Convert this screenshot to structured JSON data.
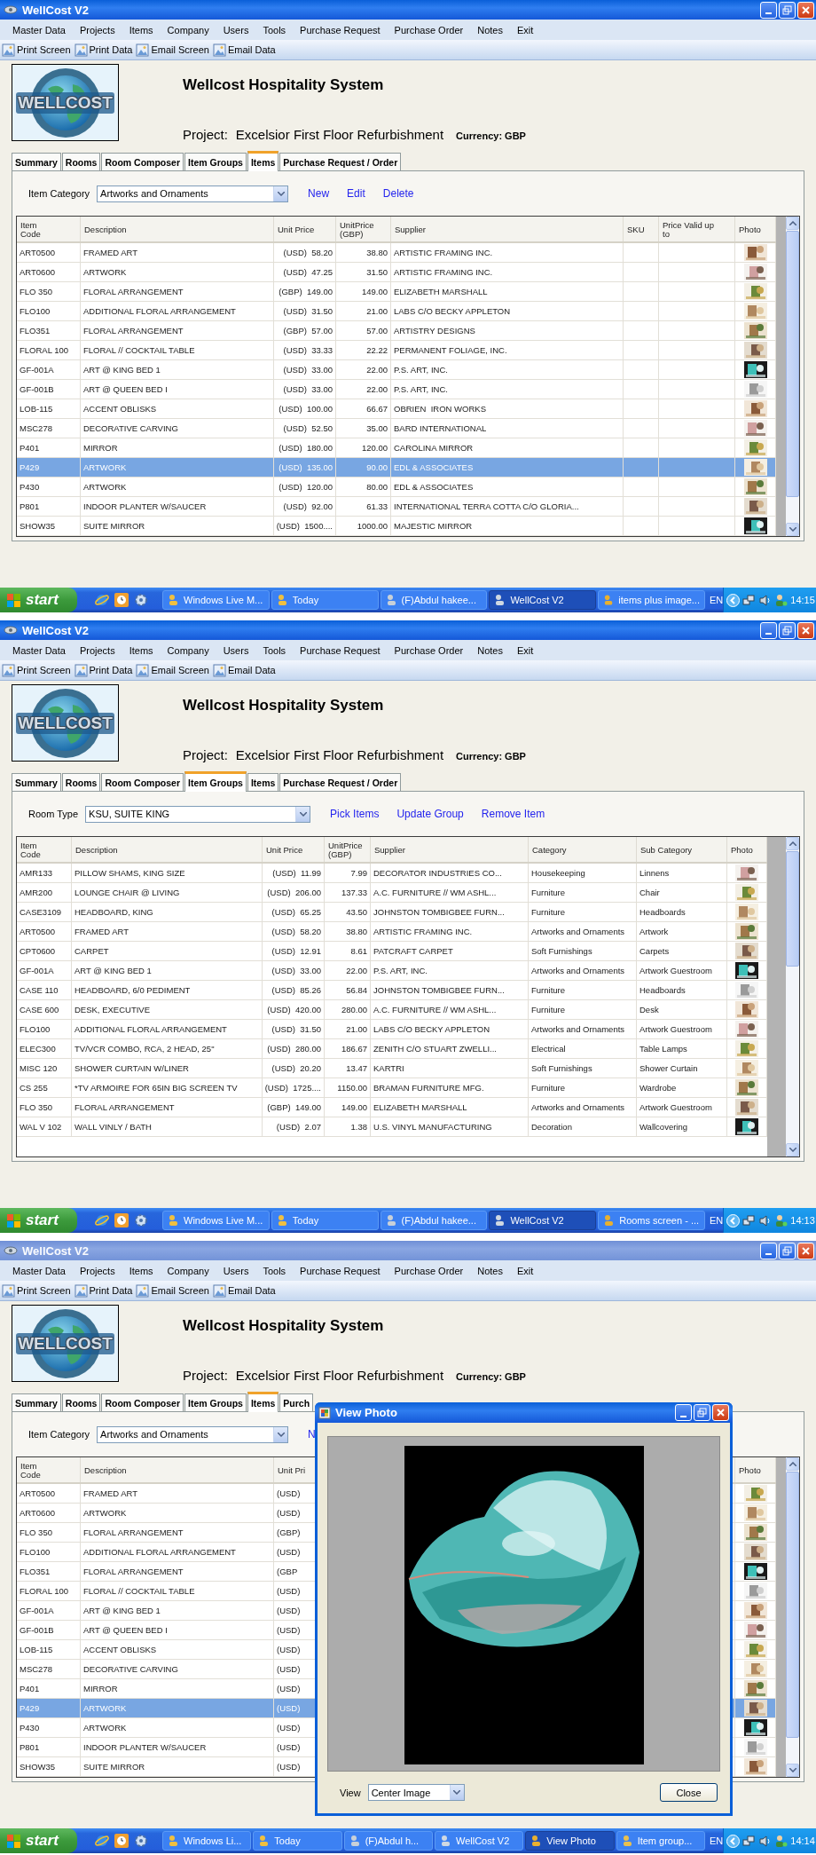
{
  "screens": [
    {
      "window": {
        "title": "WellCost V2",
        "active": true
      },
      "menu": [
        "Master Data",
        "Projects",
        "Items",
        "Company",
        "Users",
        "Tools",
        "Purchase Request",
        "Purchase Order",
        "Notes",
        "Exit"
      ],
      "toolbar": [
        "Print Screen",
        "Print Data",
        "Email Screen",
        "Email Data"
      ],
      "logo_text": "WELLCOST",
      "system_title": "Wellcost Hospitality System",
      "project_label": "Project:",
      "project_name": "Excelsior First Floor Refurbishment",
      "currency": "Currency: GBP",
      "tabs": [
        {
          "label": "Summary",
          "selected": false
        },
        {
          "label": "Rooms",
          "selected": false
        },
        {
          "label": "Room Composer",
          "selected": false
        },
        {
          "label": "Item Groups",
          "selected": false
        },
        {
          "label": "Items",
          "selected": true
        },
        {
          "label": "Purchase Request / Order",
          "selected": false
        }
      ],
      "filter": {
        "label": "Item Category",
        "value": "Artworks and Ornaments"
      },
      "actions": [
        "New",
        "Edit",
        "Delete"
      ],
      "table": {
        "columns": [
          {
            "label": "Item\nCode",
            "kind": "text"
          },
          {
            "label": "Description",
            "kind": "text"
          },
          {
            "label": "Unit Price",
            "kind": "text"
          },
          {
            "label": "UnitPrice\n(GBP)",
            "kind": "text"
          },
          {
            "label": "Supplier",
            "kind": "text"
          },
          {
            "label": "SKU",
            "kind": "text"
          },
          {
            "label": "Price Valid up\nto",
            "kind": "text"
          },
          {
            "label": "Photo"
          }
        ],
        "rows": [
          {
            "cells": [
              "ART0500",
              "FRAMED ART",
              "(USD)  58.20",
              "38.80",
              "ARTISTIC FRAMING INC."
            ],
            "selected": false
          },
          {
            "cells": [
              "ART0600",
              "ARTWORK",
              "(USD)  47.25",
              "31.50",
              "ARTISTIC FRAMING INC."
            ],
            "selected": false
          },
          {
            "cells": [
              "FLO 350",
              "FLORAL ARRANGEMENT",
              "(GBP)  149.00",
              "149.00",
              "ELIZABETH MARSHALL"
            ],
            "selected": false
          },
          {
            "cells": [
              "FLO100",
              "ADDITIONAL FLORAL ARRANGEMENT",
              "(USD)  31.50",
              "21.00",
              "LABS C/O BECKY APPLETON"
            ],
            "selected": false
          },
          {
            "cells": [
              "FLO351",
              "FLORAL ARRANGEMENT",
              "(GBP)  57.00",
              "57.00",
              "ARTISTRY DESIGNS"
            ],
            "selected": false
          },
          {
            "cells": [
              "FLORAL 100",
              "FLORAL // COCKTAIL TABLE",
              "(USD)  33.33",
              "22.22",
              "PERMANENT FOLIAGE, INC."
            ],
            "selected": false
          },
          {
            "cells": [
              "GF-001A",
              "ART @ KING BED 1",
              "(USD)  33.00",
              "22.00",
              "P.S. ART, INC."
            ],
            "selected": false
          },
          {
            "cells": [
              "GF-001B",
              "ART @ QUEEN BED I",
              "(USD)  33.00",
              "22.00",
              "P.S. ART, INC."
            ],
            "selected": false
          },
          {
            "cells": [
              "LOB-115",
              "ACCENT OBLISKS",
              "(USD)  100.00",
              "66.67",
              "OBRIEN  IRON WORKS"
            ],
            "selected": false
          },
          {
            "cells": [
              "MSC278",
              "DECORATIVE CARVING",
              "(USD)  52.50",
              "35.00",
              "BARD INTERNATIONAL"
            ],
            "selected": false
          },
          {
            "cells": [
              "P401",
              "MIRROR",
              "(USD)  180.00",
              "120.00",
              "CAROLINA MIRROR"
            ],
            "selected": false
          },
          {
            "cells": [
              "P429",
              "ARTWORK",
              "(USD)  135.00",
              "90.00",
              "EDL & ASSOCIATES"
            ],
            "selected": true
          },
          {
            "cells": [
              "P430",
              "ARTWORK",
              "(USD)  120.00",
              "80.00",
              "EDL & ASSOCIATES"
            ],
            "selected": false
          },
          {
            "cells": [
              "P801",
              "INDOOR PLANTER W/SAUCER",
              "(USD)  92.00",
              "61.33",
              "INTERNATIONAL TERRA COTTA C/O GLORIA..."
            ],
            "selected": false
          },
          {
            "cells": [
              "SHOW35",
              "SUITE MIRROR",
              "(USD)  1500....",
              "1000.00",
              "MAJESTIC MIRROR"
            ],
            "selected": false
          }
        ]
      },
      "taskbar": {
        "start": "start",
        "tasks": [
          {
            "label": "Windows Live M...",
            "selected": false
          },
          {
            "label": "Today",
            "selected": false
          },
          {
            "label": "(F)Abdul hakee...",
            "selected": false
          },
          {
            "label": "WellCost V2",
            "selected": true
          },
          {
            "label": "items plus image...",
            "selected": false
          }
        ],
        "language": "EN",
        "clock": "14:15"
      }
    },
    {
      "window": {
        "title": "WellCost V2",
        "active": true
      },
      "menu": [
        "Master Data",
        "Projects",
        "Items",
        "Company",
        "Users",
        "Tools",
        "Purchase Request",
        "Purchase Order",
        "Notes",
        "Exit"
      ],
      "toolbar": [
        "Print Screen",
        "Print Data",
        "Email Screen",
        "Email Data"
      ],
      "logo_text": "WELLCOST",
      "system_title": "Wellcost Hospitality System",
      "project_label": "Project:",
      "project_name": "Excelsior First Floor Refurbishment",
      "currency": "Currency: GBP",
      "tabs": [
        {
          "label": "Summary",
          "selected": false
        },
        {
          "label": "Rooms",
          "selected": false
        },
        {
          "label": "Room Composer",
          "selected": false
        },
        {
          "label": "Item Groups",
          "selected": true
        },
        {
          "label": "Items",
          "selected": false
        },
        {
          "label": "Purchase Request / Order",
          "selected": false
        }
      ],
      "filter": {
        "label": "Room Type",
        "value": "KSU, SUITE KING"
      },
      "actions": [
        "Pick Items",
        "Update Group",
        "Remove Item"
      ],
      "table": {
        "columns": [
          {
            "label": "Item\nCode",
            "kind": "text"
          },
          {
            "label": "Description",
            "kind": "text"
          },
          {
            "label": "Unit Price",
            "kind": "text"
          },
          {
            "label": "UnitPrice\n(GBP)",
            "kind": "text"
          },
          {
            "label": "Supplier",
            "kind": "text"
          },
          {
            "label": "Category",
            "kind": "text"
          },
          {
            "label": "Sub Category",
            "kind": "text"
          },
          {
            "label": "Photo"
          }
        ],
        "rows": [
          {
            "cells": [
              "AMR133",
              "PILLOW SHAMS, KING SIZE",
              "(USD)  11.99",
              "7.99",
              "DECORATOR INDUSTRIES CO...",
              "Housekeeping",
              "Linnens"
            ],
            "selected": false
          },
          {
            "cells": [
              "AMR200",
              "LOUNGE CHAIR @ LIVING",
              "(USD)  206.00",
              "137.33",
              "A.C. FURNITURE // WM ASHL...",
              "Furniture",
              "Chair"
            ],
            "selected": false
          },
          {
            "cells": [
              "CASE3109",
              "HEADBOARD, KING",
              "(USD)  65.25",
              "43.50",
              "JOHNSTON TOMBIGBEE FURN...",
              "Furniture",
              "Headboards"
            ],
            "selected": false
          },
          {
            "cells": [
              "ART0500",
              "FRAMED ART",
              "(USD)  58.20",
              "38.80",
              "ARTISTIC FRAMING INC.",
              "Artworks and Ornaments",
              "Artwork"
            ],
            "selected": false
          },
          {
            "cells": [
              "CPT0600",
              "CARPET",
              "(USD)  12.91",
              "8.61",
              "PATCRAFT CARPET",
              "Soft Furnishings",
              "Carpets"
            ],
            "selected": false
          },
          {
            "cells": [
              "GF-001A",
              "ART @ KING BED 1",
              "(USD)  33.00",
              "22.00",
              "P.S. ART, INC.",
              "Artworks and Ornaments",
              "Artwork Guestroom"
            ],
            "selected": false
          },
          {
            "cells": [
              "CASE 110",
              "HEADBOARD, 6/0 PEDIMENT",
              "(USD)  85.26",
              "56.84",
              "JOHNSTON TOMBIGBEE FURN...",
              "Furniture",
              "Headboards"
            ],
            "selected": false
          },
          {
            "cells": [
              "CASE 600",
              "DESK, EXECUTIVE",
              "(USD)  420.00",
              "280.00",
              "A.C. FURNITURE // WM ASHL...",
              "Furniture",
              "Desk"
            ],
            "selected": false
          },
          {
            "cells": [
              "FLO100",
              "ADDITIONAL FLORAL ARRANGEMENT",
              "(USD)  31.50",
              "21.00",
              "LABS C/O BECKY APPLETON",
              "Artworks and Ornaments",
              "Artwork Guestroom"
            ],
            "selected": false
          },
          {
            "cells": [
              "ELEC300",
              "TV/VCR COMBO, RCA, 2 HEAD, 25\"",
              "(USD)  280.00",
              "186.67",
              "ZENITH C/O STUART ZWELLI...",
              "Electrical",
              "Table Lamps"
            ],
            "selected": false
          },
          {
            "cells": [
              "MISC 120",
              "SHOWER CURTAIN W/LINER",
              "(USD)  20.20",
              "13.47",
              "KARTRI",
              "Soft Furnishings",
              "Shower Curtain"
            ],
            "selected": false
          },
          {
            "cells": [
              "CS 255",
              "*TV ARMOIRE FOR 65IN BIG SCREEN TV",
              "(USD)  1725....",
              "1150.00",
              "BRAMAN FURNITURE MFG.",
              "Furniture",
              "Wardrobe"
            ],
            "selected": false
          },
          {
            "cells": [
              "FLO 350",
              "FLORAL ARRANGEMENT",
              "(GBP)  149.00",
              "149.00",
              "ELIZABETH MARSHALL",
              "Artworks and Ornaments",
              "Artwork Guestroom"
            ],
            "selected": false
          },
          {
            "cells": [
              "WAL V 102",
              "WALL VINLY / BATH",
              "(USD)  2.07",
              "1.38",
              "U.S. VINYL MANUFACTURING",
              "Decoration",
              "Wallcovering"
            ],
            "selected": false
          }
        ]
      },
      "taskbar": {
        "start": "start",
        "tasks": [
          {
            "label": "Windows Live M...",
            "selected": false
          },
          {
            "label": "Today",
            "selected": false
          },
          {
            "label": "(F)Abdul hakee...",
            "selected": false
          },
          {
            "label": "WellCost V2",
            "selected": true
          },
          {
            "label": "Rooms screen - ...",
            "selected": false
          }
        ],
        "language": "EN",
        "clock": "14:13"
      }
    },
    {
      "window": {
        "title": "WellCost V2",
        "active": false
      },
      "menu": [
        "Master Data",
        "Projects",
        "Items",
        "Company",
        "Users",
        "Tools",
        "Purchase Request",
        "Purchase Order",
        "Notes",
        "Exit"
      ],
      "toolbar": [
        "Print Screen",
        "Print Data",
        "Email Screen",
        "Email Data"
      ],
      "logo_text": "WELLCOST",
      "system_title": "Wellcost Hospitality System",
      "project_label": "Project:",
      "project_name": "Excelsior First Floor Refurbishment",
      "currency": "Currency: GBP",
      "tabs": [
        {
          "label": "Summary",
          "selected": false
        },
        {
          "label": "Rooms",
          "selected": false
        },
        {
          "label": "Room Composer",
          "selected": false
        },
        {
          "label": "Item Groups",
          "selected": false
        },
        {
          "label": "Items",
          "selected": true
        },
        {
          "label": "Purch",
          "selected": false
        }
      ],
      "filter": {
        "label": "Item Category",
        "value": "Artworks and Ornaments"
      },
      "actions": [
        "N"
      ],
      "table": {
        "columns": [
          {
            "label": "Item\nCode",
            "kind": "text"
          },
          {
            "label": "Description",
            "kind": "text"
          },
          {
            "label": "Unit Pri",
            "kind": "text"
          },
          {
            "label": "Photo"
          }
        ],
        "rows": [
          {
            "cells": [
              "ART0500",
              "FRAMED ART",
              "(USD)"
            ],
            "selected": false
          },
          {
            "cells": [
              "ART0600",
              "ARTWORK",
              "(USD)"
            ],
            "selected": false
          },
          {
            "cells": [
              "FLO 350",
              "FLORAL ARRANGEMENT",
              "(GBP)"
            ],
            "selected": false
          },
          {
            "cells": [
              "FLO100",
              "ADDITIONAL FLORAL ARRANGEMENT",
              "(USD)"
            ],
            "selected": false
          },
          {
            "cells": [
              "FLO351",
              "FLORAL ARRANGEMENT",
              "(GBP"
            ],
            "selected": false
          },
          {
            "cells": [
              "FLORAL 100",
              "FLORAL // COCKTAIL TABLE",
              "(USD)"
            ],
            "selected": false
          },
          {
            "cells": [
              "GF-001A",
              "ART @ KING BED 1",
              "(USD)"
            ],
            "selected": false
          },
          {
            "cells": [
              "GF-001B",
              "ART @ QUEEN BED I",
              "(USD)"
            ],
            "selected": false
          },
          {
            "cells": [
              "LOB-115",
              "ACCENT OBLISKS",
              "(USD)"
            ],
            "selected": false
          },
          {
            "cells": [
              "MSC278",
              "DECORATIVE CARVING",
              "(USD)"
            ],
            "selected": false
          },
          {
            "cells": [
              "P401",
              "MIRROR",
              "(USD)"
            ],
            "selected": false
          },
          {
            "cells": [
              "P429",
              "ARTWORK",
              "(USD)"
            ],
            "selected": true
          },
          {
            "cells": [
              "P430",
              "ARTWORK",
              "(USD)"
            ],
            "selected": false
          },
          {
            "cells": [
              "P801",
              "INDOOR PLANTER W/SAUCER",
              "(USD)"
            ],
            "selected": false
          },
          {
            "cells": [
              "SHOW35",
              "SUITE MIRROR",
              "(USD)"
            ],
            "selected": false
          }
        ]
      },
      "dialog": {
        "title": "View Photo",
        "view_label": "View",
        "view_value": "Center Image",
        "close_label": "Close"
      },
      "taskbar": {
        "start": "start",
        "tasks": [
          {
            "label": "Windows Li...",
            "selected": false
          },
          {
            "label": "Today",
            "selected": false
          },
          {
            "label": "(F)Abdul h...",
            "selected": false
          },
          {
            "label": "WellCost V2",
            "selected": false
          },
          {
            "label": "View Photo",
            "selected": true
          },
          {
            "label": "Item group...",
            "selected": false
          }
        ],
        "language": "EN",
        "clock": "14:14"
      }
    }
  ]
}
